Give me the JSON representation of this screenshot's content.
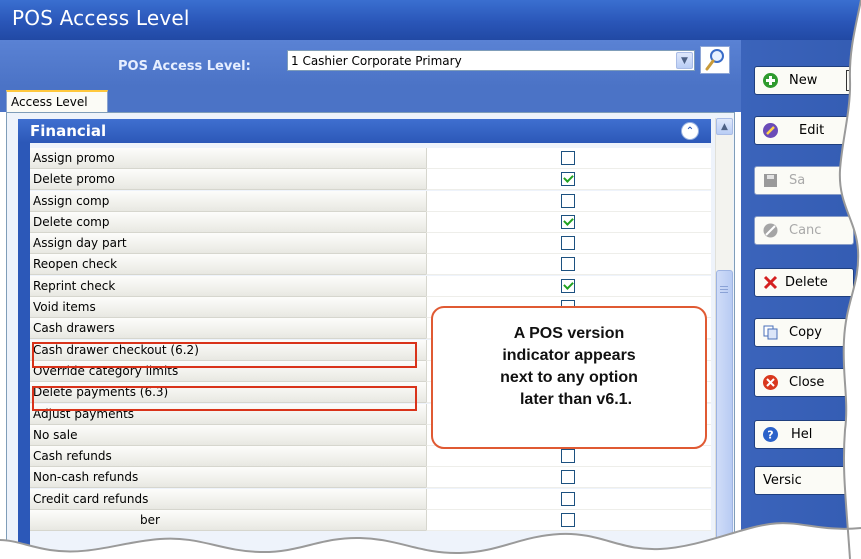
{
  "window": {
    "title": "POS Access Level"
  },
  "header": {
    "label": "POS Access Level:",
    "selected_level": "1 Cashier Corporate Primary"
  },
  "tabs": [
    {
      "label": "Access Level"
    }
  ],
  "section": {
    "title": "Financial"
  },
  "rows": [
    {
      "label": "Assign promo",
      "checked": false
    },
    {
      "label": "Delete promo",
      "checked": true
    },
    {
      "label": "Assign comp",
      "checked": false
    },
    {
      "label": "Delete comp",
      "checked": true
    },
    {
      "label": "Assign day part",
      "checked": false
    },
    {
      "label": "Reopen check",
      "checked": false
    },
    {
      "label": "Reprint check",
      "checked": true
    },
    {
      "label": "Void items",
      "checked": false
    },
    {
      "label": "Cash drawers",
      "checked": false
    },
    {
      "label": "Cash drawer checkout (6.2)",
      "checked": false
    },
    {
      "label": "Override category limits",
      "checked": false
    },
    {
      "label": "Delete payments (6.3)",
      "checked": false
    },
    {
      "label": "Adjust payments",
      "checked": false
    },
    {
      "label": "No sale",
      "checked": false
    },
    {
      "label": "Cash refunds",
      "checked": false
    },
    {
      "label": "Non-cash refunds",
      "checked": false
    },
    {
      "label": "Credit card refunds",
      "checked": false
    },
    {
      "label": "ber",
      "checked": false
    }
  ],
  "callout": {
    "lines": [
      "A POS version",
      "indicator appears",
      "next to any option",
      "later than v6.1."
    ]
  },
  "actions": {
    "new": "New",
    "edit": "Edit",
    "save": "Sa",
    "cancel": "Canc",
    "delete": "Delete",
    "copy": "Copy",
    "close": "Close",
    "help": "Hel",
    "version": "Versic"
  }
}
